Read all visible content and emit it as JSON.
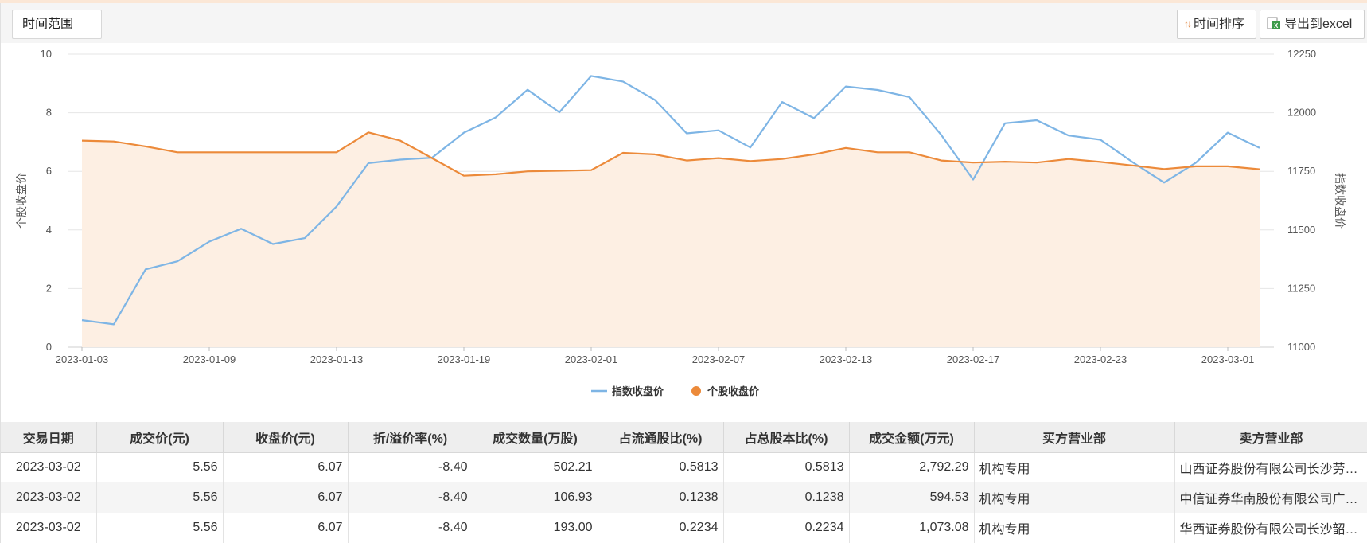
{
  "toolbar": {
    "range_label": "时间范围",
    "sort_label": "时间排序",
    "export_label": "导出到excel",
    "sort_icon": "sort-arrows-icon",
    "export_icon": "excel-icon"
  },
  "colors": {
    "index_line": "#7eb5e5",
    "stock_line": "#ec8a3a",
    "area_fill": "#fdefe3",
    "header_bg": "#eeeeee"
  },
  "chart_data": {
    "type": "line",
    "x": [
      "2023-01-03",
      "2023-01-04",
      "2023-01-05",
      "2023-01-06",
      "2023-01-09",
      "2023-01-10",
      "2023-01-11",
      "2023-01-12",
      "2023-01-13",
      "2023-01-16",
      "2023-01-17",
      "2023-01-18",
      "2023-01-19",
      "2023-01-20",
      "2023-01-30",
      "2023-01-31",
      "2023-02-01",
      "2023-02-02",
      "2023-02-03",
      "2023-02-06",
      "2023-02-07",
      "2023-02-08",
      "2023-02-09",
      "2023-02-10",
      "2023-02-13",
      "2023-02-14",
      "2023-02-15",
      "2023-02-16",
      "2023-02-17",
      "2023-02-20",
      "2023-02-21",
      "2023-02-22",
      "2023-02-23",
      "2023-02-24",
      "2023-02-27",
      "2023-02-28",
      "2023-03-01",
      "2023-03-02"
    ],
    "x_tick_labels": [
      "2023-01-03",
      "2023-01-09",
      "2023-01-13",
      "2023-01-19",
      "2023-02-01",
      "2023-02-07",
      "2023-02-13",
      "2023-02-17",
      "2023-02-23",
      "2023-03-01"
    ],
    "x_tick_indices": [
      0,
      4,
      8,
      12,
      16,
      20,
      24,
      28,
      32,
      36
    ],
    "ylabel_left": "个股收盘价",
    "ylabel_right": "指数收盘价",
    "ylim_left": [
      0,
      10
    ],
    "ylim_right": [
      11000,
      12250
    ],
    "yticks_left": [
      0,
      2,
      4,
      6,
      8,
      10
    ],
    "yticks_right": [
      11000,
      11250,
      11500,
      11750,
      12000,
      12250
    ],
    "series": [
      {
        "name": "指数收盘价",
        "axis": "right",
        "values": [
          11115,
          11097,
          11332,
          11366,
          11450,
          11505,
          11440,
          11465,
          11600,
          11785,
          11800,
          11808,
          11915,
          11980,
          12098,
          12002,
          12157,
          12133,
          12055,
          11912,
          11925,
          11852,
          12046,
          11977,
          12112,
          12097,
          12067,
          11905,
          11715,
          11955,
          11968,
          11903,
          11885,
          11790,
          11702,
          11787,
          11915,
          11850
        ]
      },
      {
        "name": "个股收盘价",
        "axis": "left",
        "values": [
          7.05,
          7.02,
          6.85,
          6.65,
          6.65,
          6.65,
          6.65,
          6.65,
          6.65,
          7.33,
          7.05,
          6.45,
          5.85,
          5.9,
          6.0,
          6.02,
          6.04,
          6.63,
          6.58,
          6.37,
          6.45,
          6.35,
          6.42,
          6.58,
          6.8,
          6.65,
          6.65,
          6.37,
          6.3,
          6.33,
          6.3,
          6.42,
          6.32,
          6.2,
          6.08,
          6.17,
          6.17,
          6.07
        ]
      }
    ],
    "legend": [
      "指数收盘价",
      "个股收盘价"
    ],
    "legend_position": "bottom-center",
    "grid": true
  },
  "table": {
    "headers": [
      "交易日期",
      "成交价(元)",
      "收盘价(元)",
      "折/溢价率(%)",
      "成交数量(万股)",
      "占流通股比(%)",
      "占总股本比(%)",
      "成交金额(万元)",
      "买方营业部",
      "卖方营业部"
    ],
    "rows": [
      [
        "2023-03-02",
        "5.56",
        "6.07",
        "-8.40",
        "502.21",
        "0.5813",
        "0.5813",
        "2,792.29",
        "机构专用",
        "山西证券股份有限公司长沙劳…"
      ],
      [
        "2023-03-02",
        "5.56",
        "6.07",
        "-8.40",
        "106.93",
        "0.1238",
        "0.1238",
        "594.53",
        "机构专用",
        "中信证券华南股份有限公司广…"
      ],
      [
        "2023-03-02",
        "5.56",
        "6.07",
        "-8.40",
        "193.00",
        "0.2234",
        "0.2234",
        "1,073.08",
        "机构专用",
        "华西证券股份有限公司长沙韶…"
      ]
    ]
  }
}
